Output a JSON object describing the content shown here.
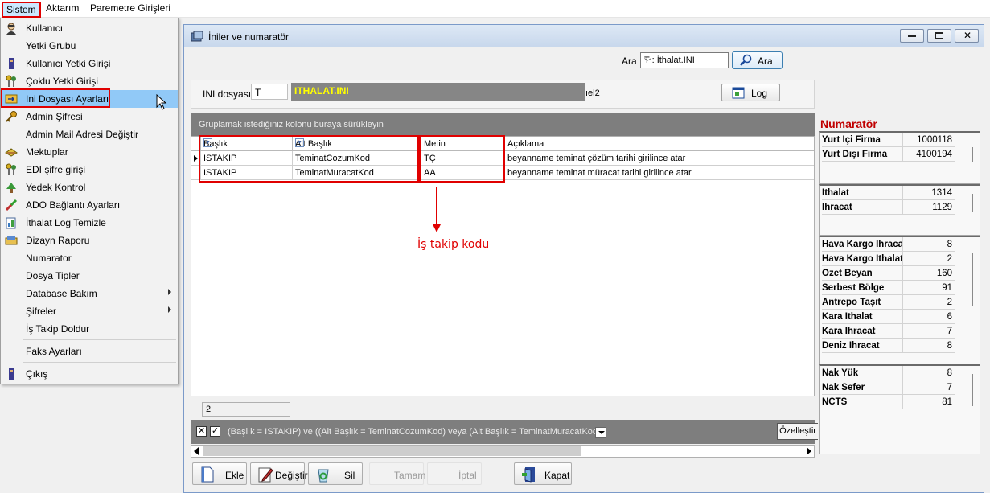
{
  "menubar": {
    "items": [
      "Sistem",
      "Aktarım",
      "Paremetre Girişleri"
    ]
  },
  "sistem_menu": {
    "items": [
      {
        "label": "Kullanıcı",
        "icon": "user-icon"
      },
      {
        "label": "Yetki Grubu",
        "icon": ""
      },
      {
        "label": "Kullanıcı Yetki Girişi",
        "icon": "user-key-icon"
      },
      {
        "label": "Çoklu Yetki Girişi",
        "icon": "keys-icon"
      },
      {
        "label": "Ini Dosyası  Ayarları",
        "icon": "ini-file-icon"
      },
      {
        "label": "Admin Şifresi",
        "icon": "key-icon"
      },
      {
        "label": "Admin Mail Adresi Değiştir",
        "icon": ""
      },
      {
        "label": "Mektuplar",
        "icon": "letters-icon"
      },
      {
        "label": "EDI şifre girişi",
        "icon": "keys-icon"
      },
      {
        "label": "Yedek Kontrol",
        "icon": "backup-icon"
      },
      {
        "label": "ADO Bağlantı Ayarları",
        "icon": "connection-icon"
      },
      {
        "label": "İthalat Log Temizle",
        "icon": "log-clean-icon"
      },
      {
        "label": "Dizayn Raporu",
        "icon": "report-icon"
      },
      {
        "label": "Numarator",
        "icon": ""
      },
      {
        "label": "Dosya Tipler",
        "icon": ""
      },
      {
        "label": "Database Bakım",
        "icon": ""
      },
      {
        "label": "Şifreler",
        "icon": ""
      },
      {
        "label": "İş Takip Doldur",
        "icon": ""
      },
      {
        "label": "Faks Ayarları",
        "icon": ""
      },
      {
        "label": "Çıkış",
        "icon": "exit-icon"
      }
    ]
  },
  "window": {
    "title": "İniler ve numaratör",
    "search_label": "Ara",
    "search_value": "T : İthalat.INI",
    "search_button": "Ara",
    "ini_label": "INI dosyası",
    "ini_code": "T",
    "ini_name": "ITHALAT.INI",
    "ini_suffix": "ıel2",
    "log_button": "Log"
  },
  "grid": {
    "group_hint": "Gruplamak istediğiniz kolonu buraya sürükleyin",
    "columns": [
      "Başlık",
      "Alt Başlık",
      "Metin",
      "Açıklama"
    ],
    "rows": [
      [
        "ISTAKIP",
        "TeminatCozumKod",
        "TÇ",
        "beyanname teminat çözüm tarihi girilince atar"
      ],
      [
        "ISTAKIP",
        "TeminatMuracatKod",
        "AA",
        "beyanname teminat müracat tarihi girilince atar"
      ]
    ],
    "record_count": "2",
    "filter_text": "(Başlık = ISTAKIP) ve ((Alt Başlık = TeminatCozumKod) veya (Alt Başlık = TeminatMuracatKod))",
    "customize_button": "Özelleştir"
  },
  "annotation": {
    "text": "İş takip kodu"
  },
  "buttons": {
    "ekle": "Ekle",
    "degistir": "Değiştir",
    "sil": "Sil",
    "tamam": "Tamam",
    "iptal": "İptal",
    "kapat": "Kapat"
  },
  "numerator": {
    "title": "Numaratör",
    "groups": [
      [
        [
          "Yurt İçi Firma",
          "1000118"
        ],
        [
          "Yurt Dışı Firma",
          "4100194"
        ]
      ],
      [
        [
          "İthalat",
          "1314"
        ],
        [
          "İhracat",
          "1129"
        ]
      ],
      [
        [
          "Hava Kargo İhracat",
          "8"
        ],
        [
          "Hava Kargo İthalat",
          "2"
        ],
        [
          "Özet Beyan",
          "160"
        ],
        [
          "Serbest Bölge",
          "91"
        ],
        [
          "Antrepo Taşıt",
          "2"
        ],
        [
          "Kara İthalat",
          "6"
        ],
        [
          "Kara İhracat",
          "7"
        ],
        [
          "Deniz İhracat",
          "8"
        ]
      ],
      [
        [
          "Nak Yük",
          "8"
        ],
        [
          "Nak Sefer",
          "7"
        ],
        [
          "NCTS",
          "81"
        ]
      ]
    ]
  },
  "colors": {
    "highlight_red": "#e00000",
    "menu_highlight": "#91c9f7",
    "ini_name_yellow": "#ffff00",
    "numerator_title": "#c00000"
  }
}
